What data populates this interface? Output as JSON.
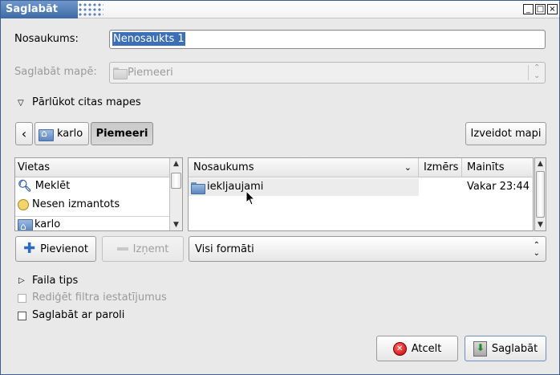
{
  "window": {
    "title": "Saglabāt",
    "buttons": {
      "minimize": "_",
      "maximize": "□",
      "close": "×"
    }
  },
  "form": {
    "name_label": "Nosaukums:",
    "name_value": "Nenosaukts 1",
    "folder_label": "Saglabāt mapē:",
    "folder_value": "Piemeeri",
    "browse_label": "Pārlūkot citas mapes"
  },
  "pathbar": {
    "back": "‹",
    "crumbs": [
      "karlo",
      "Piemeeri"
    ],
    "create_folder": "Izveidot mapi"
  },
  "places": {
    "header": "Vietas",
    "items": [
      "Meklēt",
      "Nesen izmantots",
      "karlo"
    ],
    "add": "Pievienot",
    "remove": "Izņemt"
  },
  "files": {
    "columns": {
      "name": "Nosaukums",
      "size": "Izmērs",
      "modified": "Mainīts"
    },
    "rows": [
      {
        "name": "iekljaujami",
        "size": "",
        "modified": "Vakar 23:44"
      }
    ],
    "filter": "Visi formāti"
  },
  "options": {
    "file_type": "Faila tips",
    "edit_filter": "Rediģēt filtra iestatījumus",
    "save_password": "Saglabāt ar paroli"
  },
  "actions": {
    "cancel": "Atcelt",
    "save": "Saglabāt"
  }
}
